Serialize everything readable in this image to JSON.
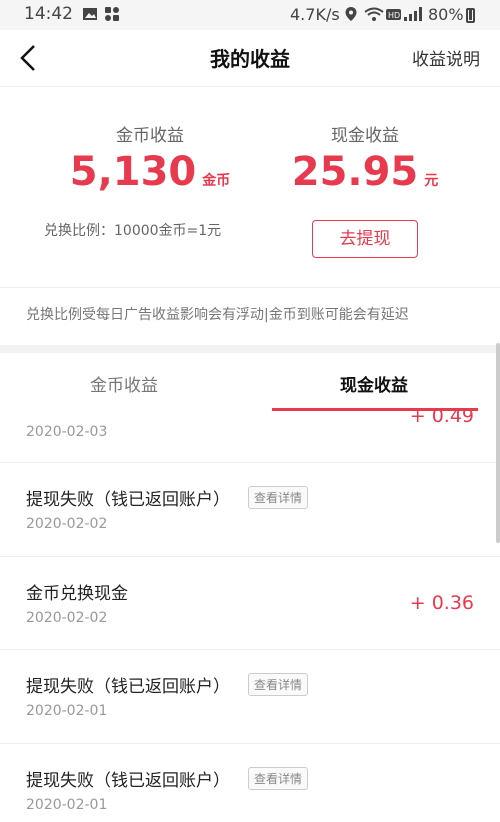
{
  "status_bar": {
    "time": "14:42",
    "speed": "4.7K/s",
    "battery": "80%"
  },
  "nav": {
    "title": "我的收益",
    "explain": "收益说明"
  },
  "summary": {
    "coin_label": "金币收益",
    "coin_value": "5,130",
    "coin_unit": "金币",
    "cash_label": "现金收益",
    "cash_value": "25.95",
    "cash_unit": "元",
    "ratio": "兑换比例：10000金币=1元",
    "withdraw": "去提现",
    "note": "兑换比例受每日广告收益影响会有浮动|金币到账可能会有延迟"
  },
  "tabs": {
    "coin": "金币收益",
    "cash": "现金收益"
  },
  "records": [
    {
      "title": "",
      "date": "2020-02-03",
      "amount": "+ 0.49",
      "detail": ""
    },
    {
      "title": "提现失败（钱已返回账户）",
      "date": "2020-02-02",
      "amount": "",
      "detail": "查看详情"
    },
    {
      "title": "金币兑换现金",
      "date": "2020-02-02",
      "amount": "+ 0.36",
      "detail": ""
    },
    {
      "title": "提现失败（钱已返回账户）",
      "date": "2020-02-01",
      "amount": "",
      "detail": "查看详情"
    },
    {
      "title": "提现失败（钱已返回账户）",
      "date": "2020-02-01",
      "amount": "",
      "detail": "查看详情"
    }
  ],
  "colors": {
    "accent": "#e83a4f"
  }
}
